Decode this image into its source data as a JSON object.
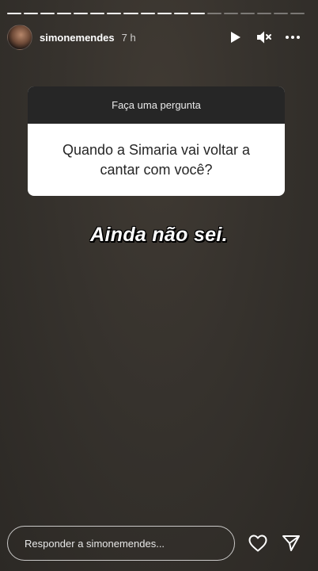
{
  "story": {
    "segment_count": 18,
    "segments_viewed": 12
  },
  "header": {
    "username": "simonemendes",
    "time": "7 h"
  },
  "icons": {
    "avatar": "profile-photo",
    "play": "play-icon",
    "mute": "speaker-muted-icon",
    "more": "more-options-icon",
    "like": "heart-icon",
    "share": "send-icon"
  },
  "question": {
    "title": "Faça uma pergunta",
    "text": "Quando a Simaria vai voltar a cantar com você?"
  },
  "answer": {
    "text": "Ainda não sei."
  },
  "footer": {
    "reply_placeholder": "Responder a simonemendes..."
  },
  "colors": {
    "background": "#36322d",
    "question_header": "#262626",
    "question_body": "#ffffff"
  }
}
